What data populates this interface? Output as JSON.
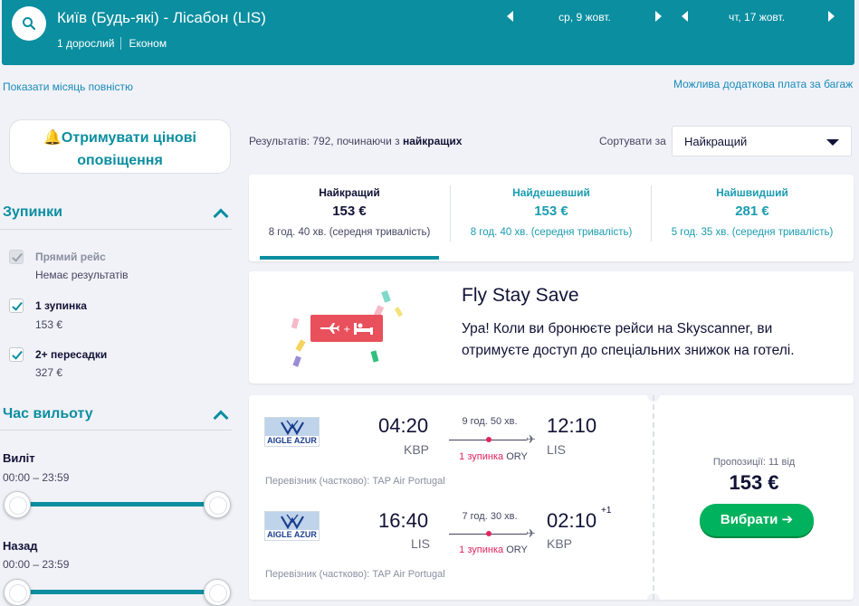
{
  "header": {
    "route": "Київ (Будь-які) - Лісабон (LIS)",
    "passengers": "1 дорослий",
    "cabin": "Економ",
    "depart_date": "ср, 9 жовт.",
    "return_date": "чт, 17 жовт."
  },
  "links": {
    "show_month": "Показати місяць повністю",
    "baggage_fee": "Можлива додаткова плата за багаж"
  },
  "sidebar": {
    "alert_button": "🔔Отримувати цінові оповіщення",
    "alert_line1": "🔔Отримувати цінові",
    "alert_line2": "оповіщення",
    "stops_title": "Зупинки",
    "stops": [
      {
        "label": "Прямий рейс",
        "sub": "Немає результатів",
        "checked": true,
        "disabled": true
      },
      {
        "label": "1 зупинка",
        "sub": "153 €",
        "checked": true,
        "disabled": false
      },
      {
        "label": "2+ пересадки",
        "sub": "327 €",
        "checked": true,
        "disabled": false
      }
    ],
    "time_title": "Час вильоту",
    "outbound_label": "Виліт",
    "outbound_range": "00:00 – 23:59",
    "return_label": "Назад",
    "return_range": "00:00 – 23:59"
  },
  "results": {
    "prefix": "Результатів: 792, починаючи з ",
    "bold": "найкращих",
    "sort_label": "Сортувати за",
    "sort_value": "Найкращий"
  },
  "tabs": [
    {
      "title": "Найкращий",
      "price": "153 €",
      "duration": "8 год. 40 хв. (середня тривалість)"
    },
    {
      "title": "Найдешевший",
      "price": "153 €",
      "duration": "8 год. 40 хв. (середня тривалість)"
    },
    {
      "title": "Найшвидший",
      "price": "281 €",
      "duration": "5 год. 35 хв. (середня тривалість)"
    }
  ],
  "promo": {
    "title": "Fly Stay Save",
    "text": "Ура! Коли ви бронюєте рейси на Skyscanner, ви отримуєте доступ до спеціальних знижок на готелі.",
    "plus": "+"
  },
  "flight": {
    "legs": [
      {
        "airline": "AIGLE AZUR",
        "dep_time": "04:20",
        "dep_code": "KBP",
        "duration": "9 год. 50 хв.",
        "stops": "1 зупинка",
        "via": "ORY",
        "arr_time": "12:10",
        "arr_code": "LIS",
        "day_offset": "",
        "carrier": "Перевізник (частково): TAP Air Portugal"
      },
      {
        "airline": "AIGLE AZUR",
        "dep_time": "16:40",
        "dep_code": "LIS",
        "duration": "7 год. 30 хв.",
        "stops": "1 зупинка",
        "via": "ORY",
        "arr_time": "02:10",
        "arr_code": "KBP",
        "day_offset": "+1",
        "carrier": "Перевізник (частково): TAP Air Portugal"
      }
    ],
    "offers": "Пропозиції: 11 від",
    "price": "153 €",
    "choose_button": "Вибрати ➔"
  },
  "colors": {
    "brand": "#0a8ea0",
    "accent_green": "#00b25d",
    "stop_red": "#e0245e",
    "promo_red": "#e8505b"
  }
}
